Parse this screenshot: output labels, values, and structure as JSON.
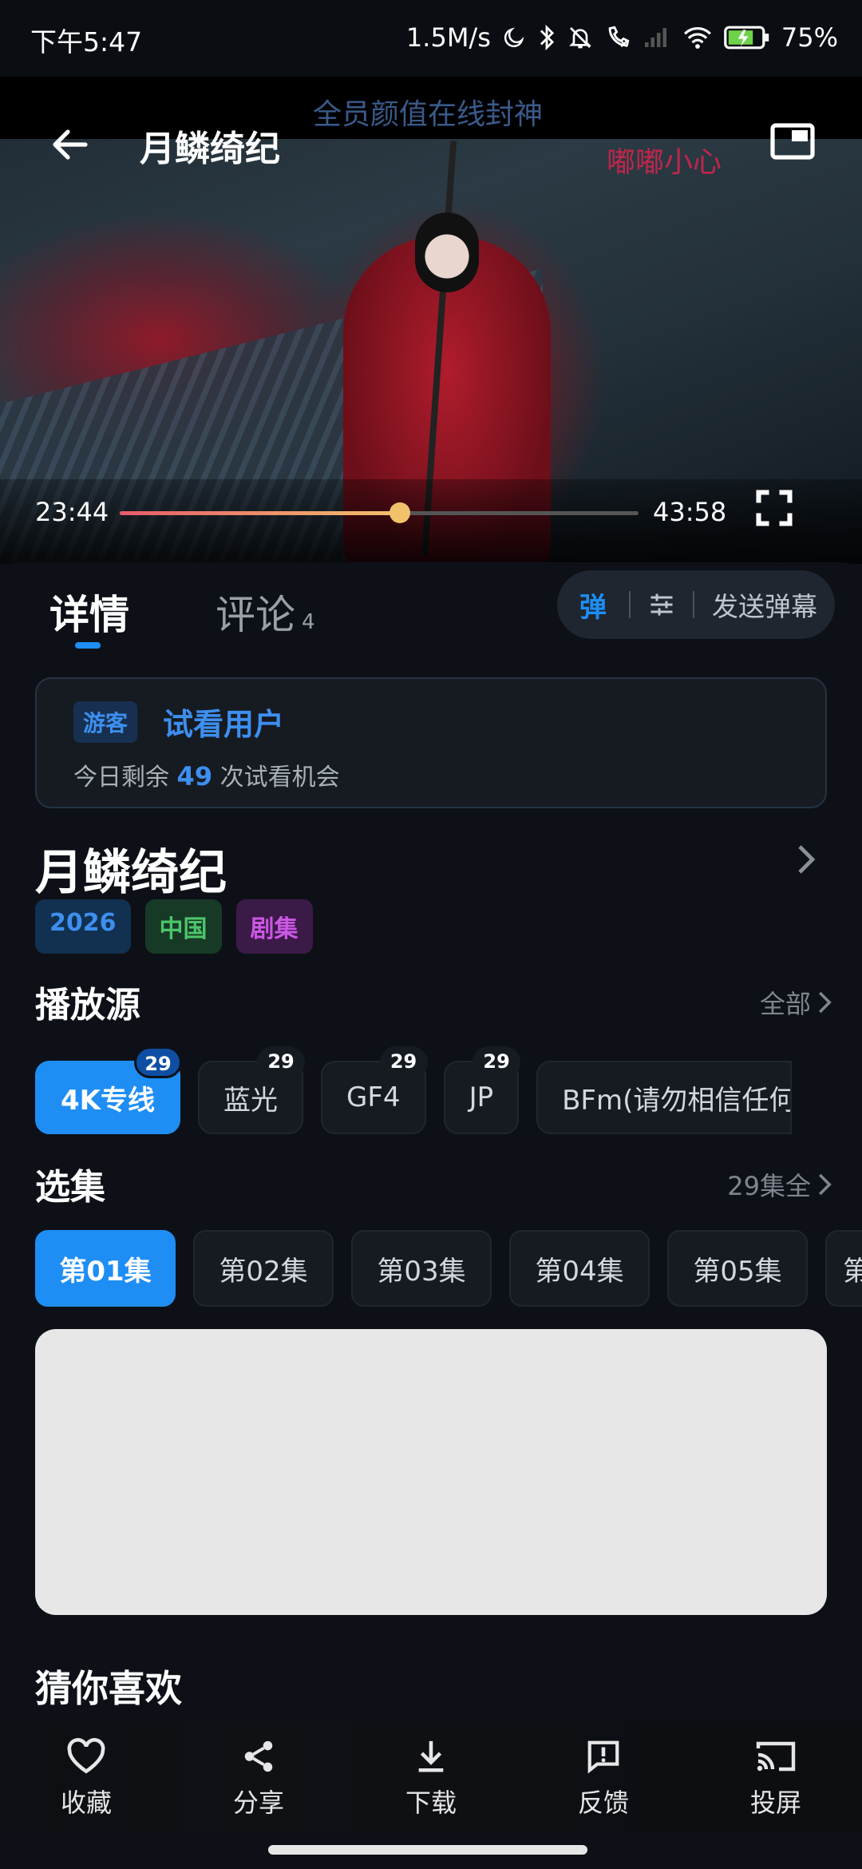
{
  "status_bar": {
    "time": "下午5:47",
    "net_speed": "1.5M/s",
    "battery": "75%"
  },
  "player": {
    "title": "月鳞绮纪",
    "danmaku": [
      "全员颜值在线封神",
      "嘟嘟小心"
    ],
    "current_time": "23:44",
    "duration": "43:58",
    "progress": 0.54
  },
  "tabs": {
    "detail": "详情",
    "comments": "评论",
    "comments_count": "4"
  },
  "danmaku_bar": {
    "toggle": "弹",
    "send": "发送弹幕"
  },
  "guest": {
    "badge": "游客",
    "name": "试看用户",
    "tip_prefix": "今日剩余",
    "remaining": "49",
    "tip_suffix": "次试看机会"
  },
  "show": {
    "title": "月鳞绮纪",
    "tags": {
      "year": "2026",
      "region": "中国",
      "type": "剧集"
    }
  },
  "sources": {
    "heading": "播放源",
    "more": "全部",
    "items": [
      {
        "label": "4K专线",
        "count": "29"
      },
      {
        "label": "蓝光",
        "count": "29"
      },
      {
        "label": "GF4",
        "count": "29"
      },
      {
        "label": "JP",
        "count": "29"
      },
      {
        "label": "BFm(请勿相信任何广"
      }
    ]
  },
  "episodes": {
    "heading": "选集",
    "more": "29集全",
    "items": [
      "第01集",
      "第02集",
      "第03集",
      "第04集",
      "第05集",
      "第"
    ]
  },
  "recommend": {
    "heading": "猜你喜欢"
  },
  "actions": {
    "favorite": "收藏",
    "share": "分享",
    "download": "下载",
    "feedback": "反馈",
    "cast": "投屏"
  }
}
